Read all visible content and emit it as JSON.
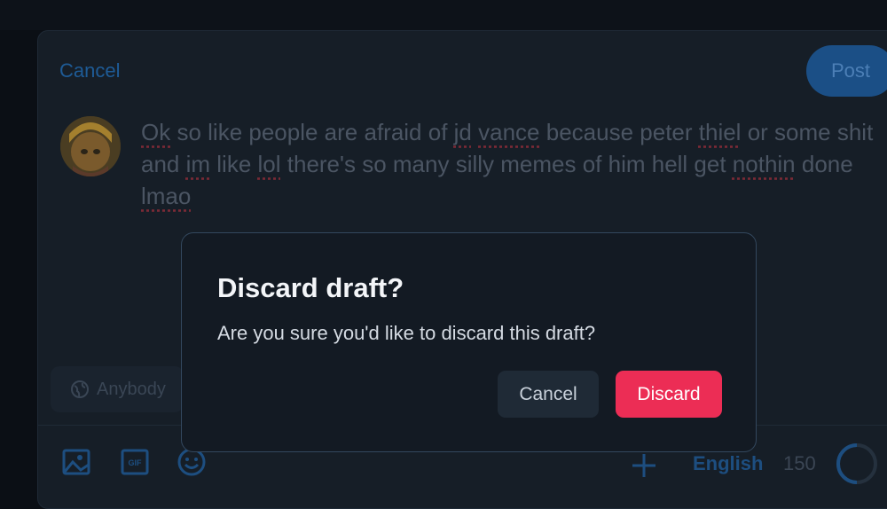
{
  "composer": {
    "cancel_label": "Cancel",
    "post_label": "Post",
    "draft_segments": [
      {
        "text": "Ok",
        "misspelled": true
      },
      {
        "text": " so like people are afraid of ",
        "misspelled": false
      },
      {
        "text": "jd",
        "misspelled": true
      },
      {
        "text": " ",
        "misspelled": false
      },
      {
        "text": "vance",
        "misspelled": true
      },
      {
        "text": " because peter ",
        "misspelled": false
      },
      {
        "text": "thiel",
        "misspelled": true
      },
      {
        "text": " or some shit and ",
        "misspelled": false
      },
      {
        "text": "im",
        "misspelled": true
      },
      {
        "text": " like ",
        "misspelled": false
      },
      {
        "text": "lol",
        "misspelled": true
      },
      {
        "text": " there's so many silly memes of him hell get ",
        "misspelled": false
      },
      {
        "text": "nothin",
        "misspelled": true
      },
      {
        "text": " done ",
        "misspelled": false
      },
      {
        "text": "lmao",
        "misspelled": true
      }
    ],
    "audience_label": "Anybody",
    "language_label": "English",
    "char_remaining": "150"
  },
  "colors": {
    "accent": "#1b4f86",
    "discard": "#ec2d55",
    "misspell_underline": "#7a2a36"
  },
  "icons": {
    "image": "image-icon",
    "gif": "gif-icon",
    "emoji": "emoji-icon",
    "thread": "plus-icon",
    "globe": "globe-icon"
  },
  "dialog": {
    "title": "Discard draft?",
    "body": "Are you sure you'd like to discard this draft?",
    "cancel_label": "Cancel",
    "discard_label": "Discard"
  }
}
